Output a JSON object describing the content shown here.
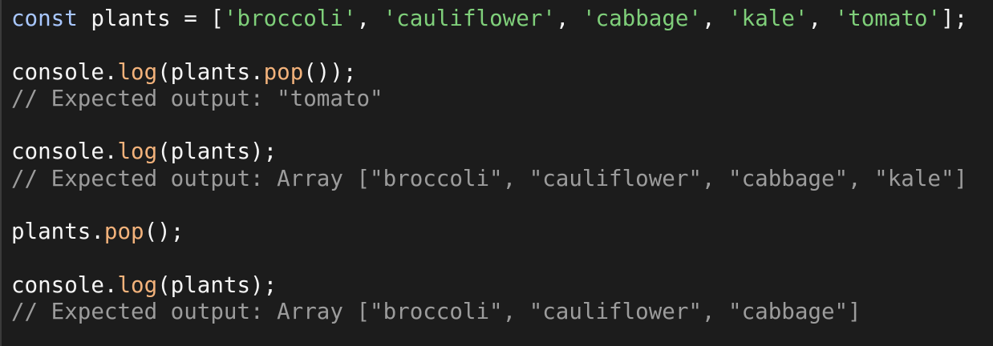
{
  "colors": {
    "background": "#1c1c1c",
    "default_text": "#f5f5f5",
    "keyword": "#a8c7ff",
    "string": "#7fcf7a",
    "method": "#f2b27b",
    "comment": "#9c9c9c"
  },
  "code": {
    "line1": {
      "keyword": "const",
      "rest_before": " plants = [",
      "s1": "'broccoli'",
      "sep1": ", ",
      "s2": "'cauliflower'",
      "sep2": ", ",
      "s3": "'cabbage'",
      "sep3": ", ",
      "s4": "'kale'",
      "sep4": ", ",
      "s5": "'tomato'",
      "end": "];"
    },
    "line3": {
      "obj": "console.",
      "method": "log",
      "mid": "(plants.",
      "method2": "pop",
      "end": "());"
    },
    "line4": {
      "comment": "// Expected output: \"tomato\""
    },
    "line6": {
      "obj": "console.",
      "method": "log",
      "end": "(plants);"
    },
    "line7": {
      "comment": "// Expected output: Array [\"broccoli\", \"cauliflower\", \"cabbage\", \"kale\"]"
    },
    "line9": {
      "obj": "plants.",
      "method": "pop",
      "end": "();"
    },
    "line11": {
      "obj": "console.",
      "method": "log",
      "end": "(plants);"
    },
    "line12": {
      "comment": "// Expected output: Array [\"broccoli\", \"cauliflower\", \"cabbage\"]"
    }
  }
}
